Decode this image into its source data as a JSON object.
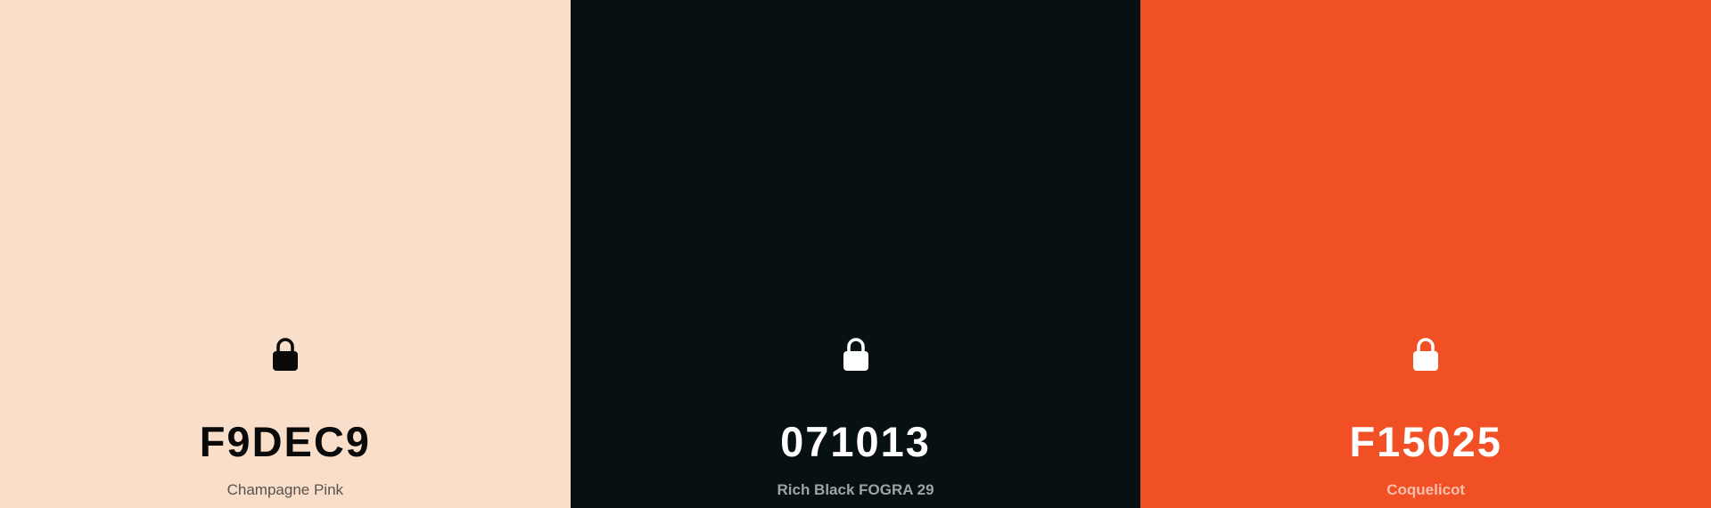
{
  "palette": {
    "swatches": [
      {
        "hex": "F9DEC9",
        "name": "Champagne Pink",
        "color": "#F9DEC9",
        "lock_icon": "lock-icon",
        "icon_color": "#0a0a0a"
      },
      {
        "hex": "071013",
        "name": "Rich Black FOGRA 29",
        "color": "#071013",
        "lock_icon": "lock-icon",
        "icon_color": "#ffffff"
      },
      {
        "hex": "F15025",
        "name": "Coquelicot",
        "color": "#F15025",
        "lock_icon": "lock-icon",
        "icon_color": "#ffffff"
      }
    ]
  }
}
